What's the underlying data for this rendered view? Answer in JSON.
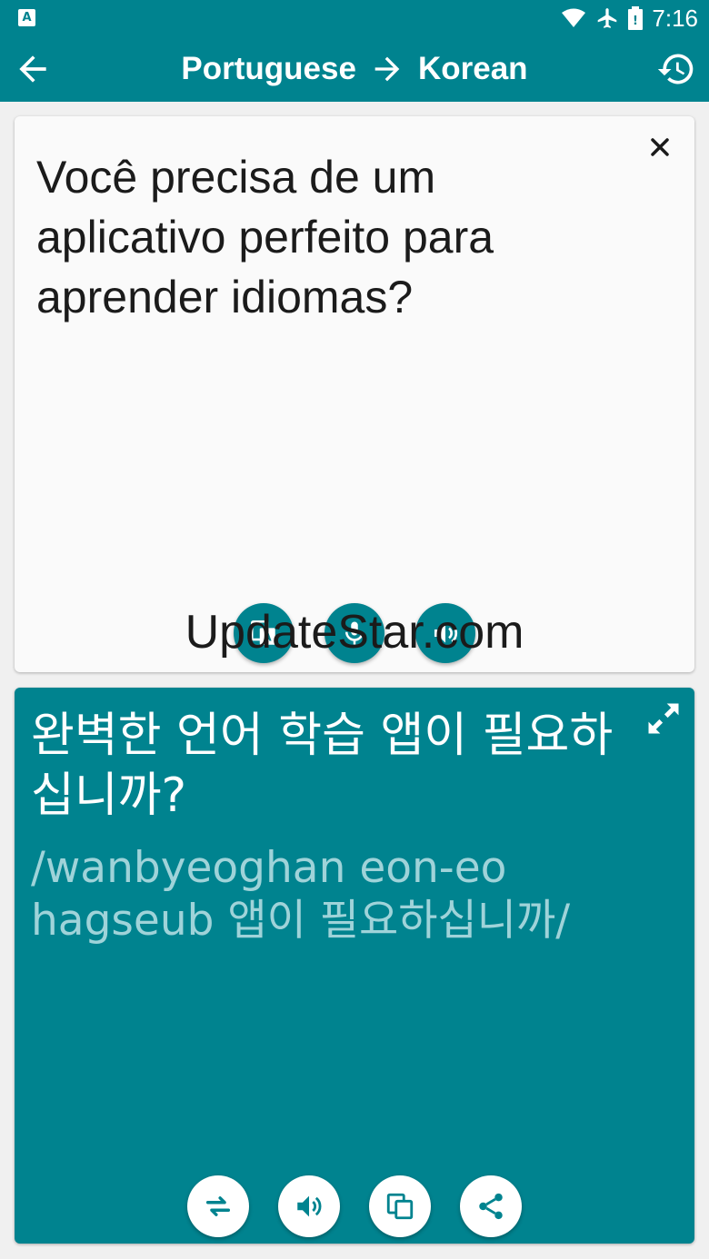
{
  "status_bar": {
    "app_icon_letter": "A",
    "time": "7:16",
    "icons": [
      "wifi-icon",
      "airplane-icon",
      "battery-icon"
    ]
  },
  "toolbar": {
    "source_language": "Portuguese",
    "target_language": "Korean",
    "back_icon": "arrow-left-icon",
    "arrow_icon": "arrow-right-icon",
    "history_icon": "history-icon"
  },
  "source": {
    "text": "Você precisa de um aplicativo perfeito para aprender idiomas?",
    "close_icon": "close-icon",
    "actions": [
      "translate-icon",
      "mic-icon",
      "listen-icon"
    ]
  },
  "result": {
    "text": "완벽한 언어 학습 앱이 필요하십니까?",
    "transliteration": "/wanbyeoghan eon-eo hagseub 앱이 필요하십니까/",
    "expand_icon": "expand-icon",
    "actions": [
      "swap-icon",
      "speaker-icon",
      "copy-icon",
      "share-icon"
    ]
  },
  "watermark": "UpdateStar.com",
  "colors": {
    "primary": "#00838f",
    "background": "#f0f0f0",
    "card": "#fafafa",
    "transliteration": "#9fd3d9"
  }
}
